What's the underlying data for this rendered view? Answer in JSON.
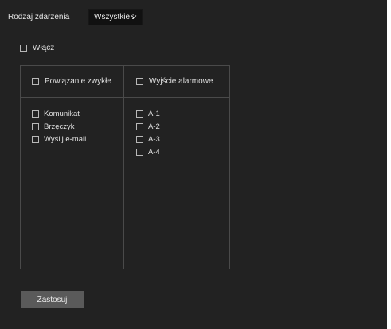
{
  "event": {
    "label": "Rodzaj zdarzenia",
    "selected": "Wszystkie zdarzenia"
  },
  "enable": {
    "label": "Włącz"
  },
  "columns": {
    "normal_linkage": {
      "header": "Powiązanie zwykłe",
      "items": [
        "Komunikat",
        "Brzęczyk",
        "Wyślij e-mail"
      ]
    },
    "alarm_output": {
      "header": "Wyjście alarmowe",
      "items": [
        "A-1",
        "A-2",
        "A-3",
        "A-4"
      ]
    }
  },
  "apply_label": "Zastosuj",
  "colors": {
    "panel_bg": "#222222",
    "select_bg": "#111111",
    "button_bg": "#5a5a5a",
    "border": "#4a4a4a",
    "text": "#e4e4e4"
  },
  "icons": {
    "dropdown": "chevron-down-icon"
  }
}
